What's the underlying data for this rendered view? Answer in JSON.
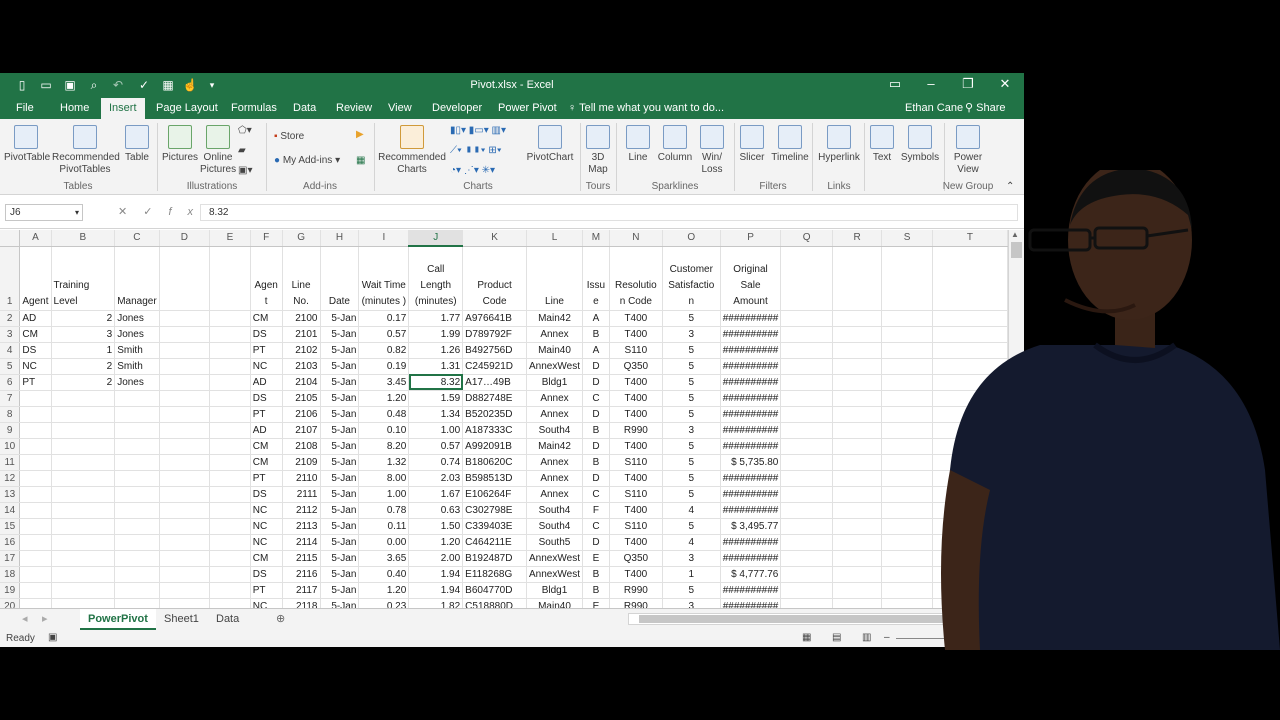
{
  "window": {
    "title": "Pivot.xlsx - Excel"
  },
  "user": {
    "name": "Ethan Cane",
    "share": "Share"
  },
  "tabs": [
    "File",
    "Home",
    "Insert",
    "Page Layout",
    "Formulas",
    "Data",
    "Review",
    "View",
    "Developer",
    "Power Pivot"
  ],
  "tellme": "Tell me what you want to do...",
  "ribbon": {
    "pivottable": "PivotTable",
    "recommended_pivot": "Recommended PivotTables",
    "table": "Table",
    "group_tables": "Tables",
    "pictures": "Pictures",
    "online_pictures": "Online Pictures",
    "group_illustrations": "Illustrations",
    "store": "Store",
    "my_addins": "My Add-ins",
    "group_addins": "Add-ins",
    "recommended_charts": "Recommended Charts",
    "pivotchart": "PivotChart",
    "group_charts": "Charts",
    "map3d": "3D Map",
    "group_tours": "Tours",
    "line": "Line",
    "column": "Column",
    "winloss": "Win/ Loss",
    "group_sparklines": "Sparklines",
    "slicer": "Slicer",
    "timeline": "Timeline",
    "group_filters": "Filters",
    "hyperlink": "Hyperlink",
    "group_links": "Links",
    "text": "Text",
    "symbols": "Symbols",
    "power_view": "Power View",
    "group_new": "New Group"
  },
  "formula": {
    "namebox": "J6",
    "value": "8.32"
  },
  "columns": [
    "A",
    "B",
    "C",
    "D",
    "E",
    "F",
    "G",
    "H",
    "I",
    "J",
    "K",
    "L",
    "M",
    "N",
    "O",
    "P",
    "Q",
    "R",
    "S",
    "T"
  ],
  "headers": {
    "A": "Agent",
    "B": "Training Level",
    "C": "Manager",
    "F": "Agen t",
    "G": "Line No.",
    "H": "Date",
    "I": "Wait Time (minutes )",
    "J": "Call Length (minutes)",
    "K": "Product Code",
    "L": "Line",
    "M": "Issu e",
    "N": "Resolutio n Code",
    "O": "Customer Satisfactio n",
    "P": "Original Sale Amount"
  },
  "left_rows": [
    [
      "AD",
      "2",
      "Jones"
    ],
    [
      "CM",
      "3",
      "Jones"
    ],
    [
      "DS",
      "1",
      "Smith"
    ],
    [
      "NC",
      "2",
      "Smith"
    ],
    [
      "PT",
      "2",
      "Jones"
    ]
  ],
  "rows": [
    [
      "CM",
      "2100",
      "5-Jan",
      "0.17",
      "1.77",
      "A976641B",
      "Main42",
      "A",
      "T400",
      "5",
      "##########"
    ],
    [
      "DS",
      "2101",
      "5-Jan",
      "0.57",
      "1.99",
      "D789792F",
      "Annex",
      "B",
      "T400",
      "3",
      "##########"
    ],
    [
      "PT",
      "2102",
      "5-Jan",
      "0.82",
      "1.26",
      "B492756D",
      "Main40",
      "A",
      "S110",
      "5",
      "##########"
    ],
    [
      "NC",
      "2103",
      "5-Jan",
      "0.19",
      "1.31",
      "C245921D",
      "AnnexWest",
      "D",
      "Q350",
      "5",
      "##########"
    ],
    [
      "AD",
      "2104",
      "5-Jan",
      "3.45",
      "8.32",
      "A17…49B",
      "Bldg1",
      "D",
      "T400",
      "5",
      "##########"
    ],
    [
      "DS",
      "2105",
      "5-Jan",
      "1.20",
      "1.59",
      "D882748E",
      "Annex",
      "C",
      "T400",
      "5",
      "##########"
    ],
    [
      "PT",
      "2106",
      "5-Jan",
      "0.48",
      "1.34",
      "B520235D",
      "Annex",
      "D",
      "T400",
      "5",
      "##########"
    ],
    [
      "AD",
      "2107",
      "5-Jan",
      "0.10",
      "1.00",
      "A187333C",
      "South4",
      "B",
      "R990",
      "3",
      "##########"
    ],
    [
      "CM",
      "2108",
      "5-Jan",
      "8.20",
      "0.57",
      "A992091B",
      "Main42",
      "D",
      "T400",
      "5",
      "##########"
    ],
    [
      "CM",
      "2109",
      "5-Jan",
      "1.32",
      "0.74",
      "B180620C",
      "Annex",
      "B",
      "S110",
      "5",
      "$ 5,735.80"
    ],
    [
      "PT",
      "2110",
      "5-Jan",
      "8.00",
      "2.03",
      "B598513D",
      "Annex",
      "D",
      "T400",
      "5",
      "##########"
    ],
    [
      "DS",
      "2111",
      "5-Jan",
      "1.00",
      "1.67",
      "E106264F",
      "Annex",
      "C",
      "S110",
      "5",
      "##########"
    ],
    [
      "NC",
      "2112",
      "5-Jan",
      "0.78",
      "0.63",
      "C302798E",
      "South4",
      "F",
      "T400",
      "4",
      "##########"
    ],
    [
      "NC",
      "2113",
      "5-Jan",
      "0.11",
      "1.50",
      "C339403E",
      "South4",
      "C",
      "S110",
      "5",
      "$ 3,495.77"
    ],
    [
      "NC",
      "2114",
      "5-Jan",
      "0.00",
      "1.20",
      "C464211E",
      "South5",
      "D",
      "T400",
      "4",
      "##########"
    ],
    [
      "CM",
      "2115",
      "5-Jan",
      "3.65",
      "2.00",
      "B192487D",
      "AnnexWest",
      "E",
      "Q350",
      "3",
      "##########"
    ],
    [
      "DS",
      "2116",
      "5-Jan",
      "0.40",
      "1.94",
      "E118268G",
      "AnnexWest",
      "B",
      "T400",
      "1",
      "$ 4,777.76"
    ],
    [
      "PT",
      "2117",
      "5-Jan",
      "1.20",
      "1.94",
      "B604770D",
      "Bldg1",
      "B",
      "R990",
      "5",
      "##########"
    ],
    [
      "NC",
      "2118",
      "5-Jan",
      "0.23",
      "1.82",
      "C518880D",
      "Main40",
      "E",
      "R990",
      "3",
      "##########"
    ]
  ],
  "sheets": [
    "PowerPivot",
    "Sheet1",
    "Data"
  ],
  "status": {
    "ready": "Ready"
  }
}
